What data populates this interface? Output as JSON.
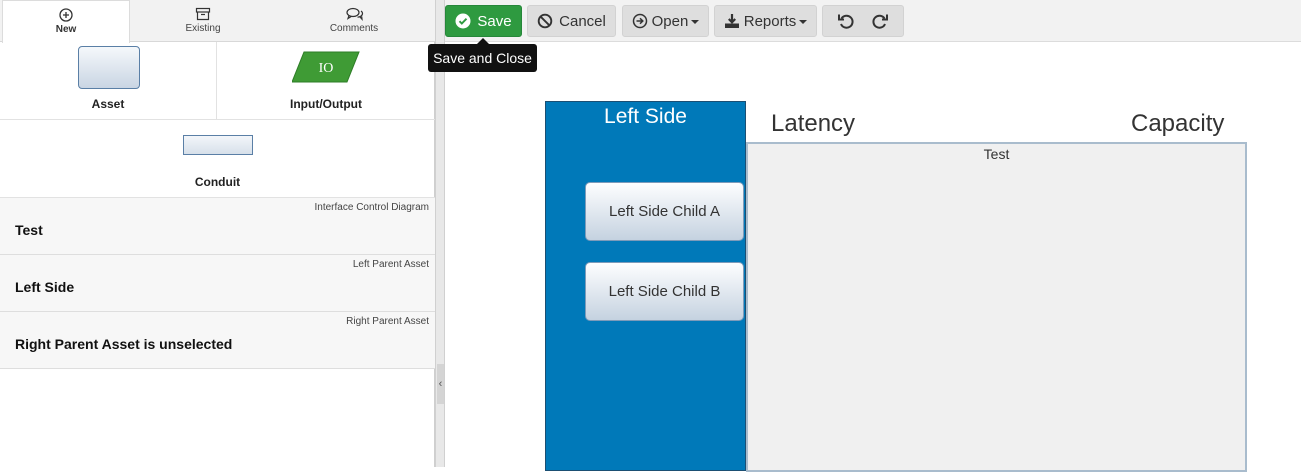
{
  "tabs": [
    {
      "label": "New",
      "icon": "plus-circle-icon"
    },
    {
      "label": "Existing",
      "icon": "archive-icon"
    },
    {
      "label": "Comments",
      "icon": "comments-icon"
    }
  ],
  "palette": {
    "asset_label": "Asset",
    "io_label": "Input/Output",
    "io_text": "IO",
    "conduit_label": "Conduit",
    "io_color": "#3f9b35",
    "asset_color": "#5a7fa6"
  },
  "info": [
    {
      "type": "Interface Control Diagram",
      "name": "Test"
    },
    {
      "type": "Left Parent Asset",
      "name": "Left Side"
    },
    {
      "type": "Right Parent Asset",
      "name": "Right Parent Asset is unselected"
    }
  ],
  "splitter": {
    "handle": "‹"
  },
  "toolbar": {
    "save": "Save",
    "cancel": "Cancel",
    "open": "Open",
    "reports": "Reports",
    "save_color": "#2e9a40"
  },
  "tooltip": "Save and Close",
  "canvas": {
    "left_side_title": "Left Side",
    "left_side_color": "#0079b9",
    "child_a": "Left Side Child A",
    "child_b": "Left Side Child B",
    "latency": "Latency",
    "capacity": "Capacity",
    "conduit_label": "Test"
  }
}
